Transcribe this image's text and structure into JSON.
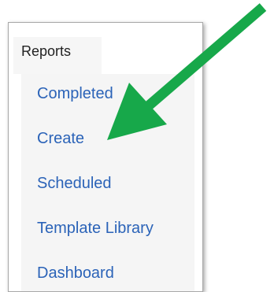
{
  "menu": {
    "tab_label": "Reports",
    "items": [
      {
        "label": "Completed"
      },
      {
        "label": "Create"
      },
      {
        "label": "Scheduled"
      },
      {
        "label": "Template Library"
      },
      {
        "label": "Dashboard"
      }
    ]
  },
  "colors": {
    "link": "#2b63b8",
    "arrow": "#17a84a",
    "panel_border": "#a8a8a8"
  },
  "annotation": {
    "arrow_icon": "arrow-down-left-icon",
    "points_to_item": "Create"
  }
}
